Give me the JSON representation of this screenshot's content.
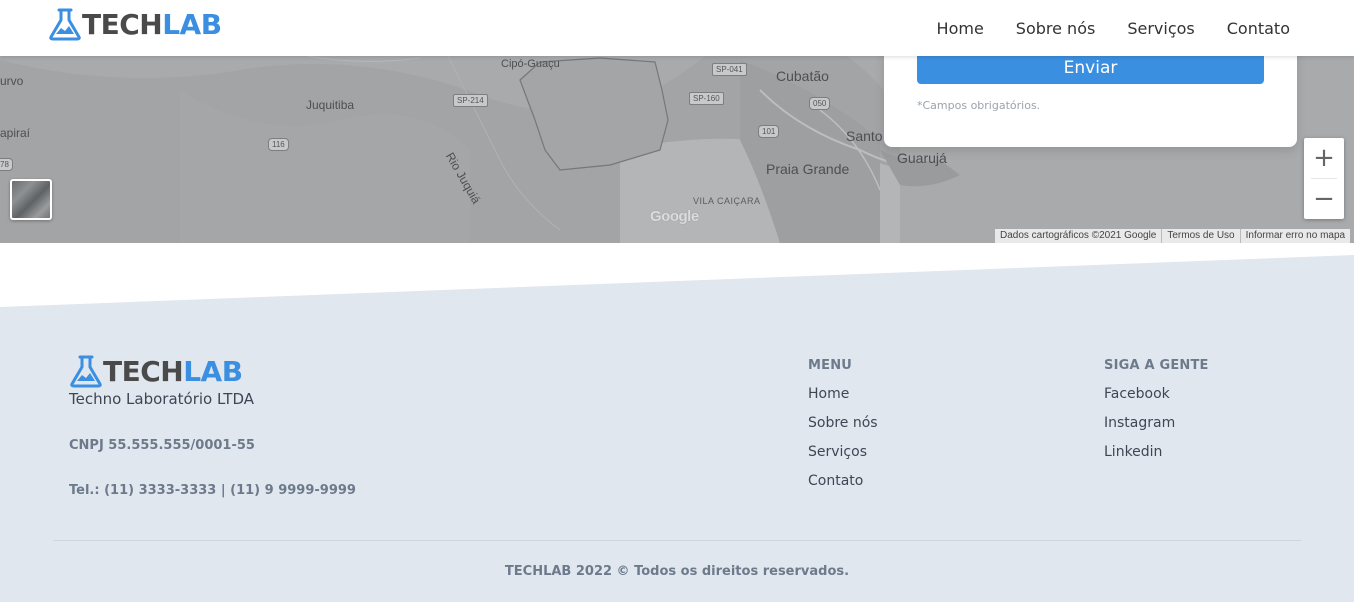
{
  "header": {
    "logo_tech": "TECH",
    "logo_lab": "LAB",
    "nav": [
      "Home",
      "Sobre nós",
      "Serviços",
      "Contato"
    ]
  },
  "map": {
    "places": {
      "curvo": "urvo",
      "cipo": "Cipó-Guaçu",
      "cubatao": "Cubatão",
      "juquitiba": "Juquitiba",
      "tapirai": "apiraí",
      "rio": "Rio Juquiá",
      "santos": "Santo",
      "praia": "Praia Grande",
      "guaruja": "Guarujá",
      "vila": "VILA CAIÇARA"
    },
    "roads": {
      "sp041": "SP-041",
      "sp214": "SP-214",
      "sp160": "SP-160",
      "r050": "050",
      "r101": "101",
      "r116": "116",
      "r78": "78"
    },
    "google_logo": "Google",
    "attribution": [
      "Dados cartográficos ©2021 Google",
      "Termos de Uso",
      "Informar erro no mapa"
    ],
    "zoom_in": "+",
    "zoom_out": "−"
  },
  "contact_form": {
    "submit_label": "Enviar",
    "required_note": "*Campos obrigatórios."
  },
  "footer": {
    "logo_tech": "TECH",
    "logo_lab": "LAB",
    "company": "Techno Laboratório LTDA",
    "cnpj": "CNPJ 55.555.555/0001-55",
    "phone": "Tel.: (11) 3333-3333 | (11) 9 9999-9999",
    "menu_title": "MENU",
    "menu_items": [
      "Home",
      "Sobre nós",
      "Serviços",
      "Contato"
    ],
    "social_title": "SIGA A GENTE",
    "social_items": [
      "Facebook",
      "Instagram",
      "Linkedin"
    ],
    "copyright": "TECHLAB 2022 © Todos os direitos reservados."
  },
  "colors": {
    "brand_blue": "#3b8fe0",
    "brand_gray": "#4a4a4a",
    "footer_bg": "#e1e7ef",
    "map_gray": "#a7a9ab"
  }
}
